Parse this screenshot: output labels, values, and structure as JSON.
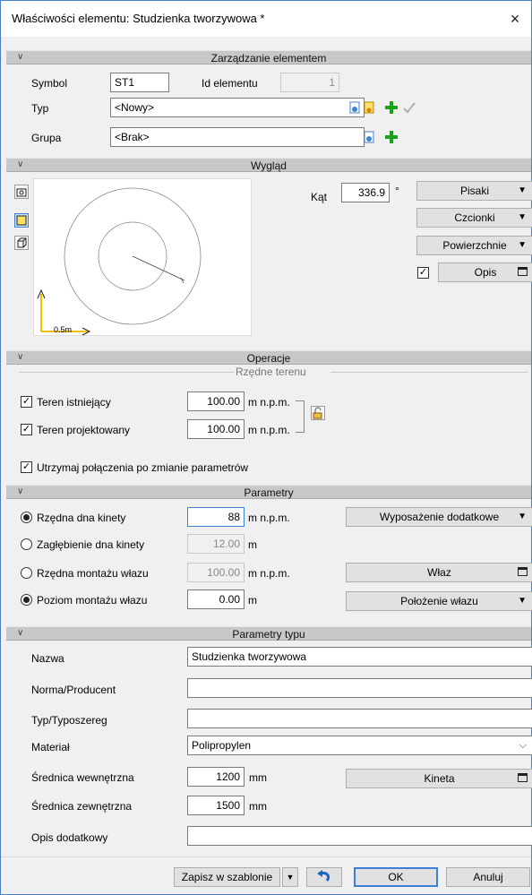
{
  "window": {
    "title": "Właściwości elementu: Studzienka tworzywowa *",
    "close": "×"
  },
  "sections": {
    "zarzadzanie": "Zarządzanie elementem",
    "wyglad": "Wygląd",
    "operacje": "Operacje",
    "parametry": "Parametry",
    "parametry_typu": "Parametry typu"
  },
  "zarzadzanie": {
    "symbol_label": "Symbol",
    "symbol_value": "ST1",
    "id_label": "Id elementu",
    "id_value": "1",
    "typ_label": "Typ",
    "typ_value": "<Nowy>",
    "grupa_label": "Grupa",
    "grupa_value": "<Brak>"
  },
  "wyglad": {
    "kat_label": "Kąt",
    "kat_value": "336.9",
    "kat_unit": "°",
    "pisaki": "Pisaki",
    "czcionki": "Czcionki",
    "powierzchnie": "Powierzchnie",
    "opis": "Opis",
    "opis_checked": true,
    "scale_label": "0.5m"
  },
  "operacje": {
    "group_title": "Rzędne terenu",
    "teren_istniejacy_label": "Teren istniejący",
    "teren_istniejacy_value": "100.00",
    "teren_projektowany_label": "Teren projektowany",
    "teren_projektowany_value": "100.00",
    "unit": "m n.p.m.",
    "utrzymaj_label": "Utrzymaj połączenia po zmianie parametrów"
  },
  "parametry": {
    "rzedna_dna_label": "Rzędna dna kinety",
    "rzedna_dna_value": "88",
    "rzedna_dna_unit": "m n.p.m.",
    "zaglebienie_label": "Zagłębienie dna kinety",
    "zaglebienie_value": "12.00",
    "zaglebienie_unit": "m",
    "rzedna_wlazu_label": "Rzędna montażu włazu",
    "rzedna_wlazu_value": "100.00",
    "rzedna_wlazu_unit": "m n.p.m.",
    "poziom_wlazu_label": "Poziom montażu włazu",
    "poziom_wlazu_value": "0.00",
    "poziom_wlazu_unit": "m",
    "wyposazenie": "Wyposażenie dodatkowe",
    "wlaz": "Właz",
    "polozenie": "Położenie włazu"
  },
  "parametry_typu": {
    "nazwa_label": "Nazwa",
    "nazwa_value": "Studzienka tworzywowa",
    "norma_label": "Norma/Producent",
    "norma_value": "",
    "typ_label": "Typ/Typoszereg",
    "typ_value": "",
    "material_label": "Materiał",
    "material_value": "Polipropylen",
    "sr_wew_label": "Średnica wewnętrzna",
    "sr_wew_value": "1200",
    "sr_wew_unit": "mm",
    "sr_zew_label": "Średnica zewnętrzna",
    "sr_zew_value": "1500",
    "sr_zew_unit": "mm",
    "kineta": "Kineta",
    "opis_label": "Opis dodatkowy",
    "opis_value": ""
  },
  "footer": {
    "zapisz": "Zapisz w szablonie",
    "ok": "OK",
    "anuluj": "Anuluj"
  }
}
